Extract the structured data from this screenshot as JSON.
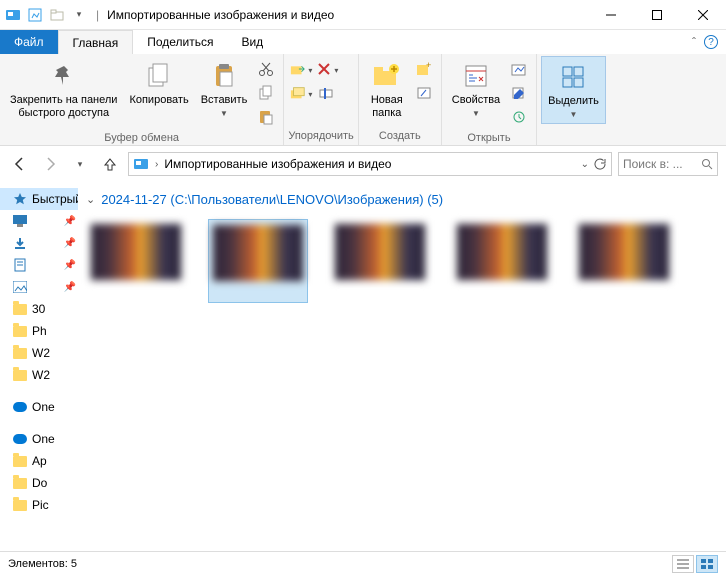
{
  "window": {
    "title": "Импортированные изображения и видео"
  },
  "tabs": {
    "file": "Файл",
    "home": "Главная",
    "share": "Поделиться",
    "view": "Вид"
  },
  "ribbon": {
    "pin": "Закрепить на панели\nбыстрого доступа",
    "copy": "Копировать",
    "paste": "Вставить",
    "clipboard_group": "Буфер обмена",
    "organize_group": "Упорядочить",
    "new_folder": "Новая\nпапка",
    "create_group": "Создать",
    "properties": "Свойства",
    "open_group": "Открыть",
    "select": "Выделить",
    "select_group": ""
  },
  "address": {
    "path": "Импортированные изображения и видео",
    "search_placeholder": "Поиск в: ..."
  },
  "nav": {
    "quick": "Быстрый доступ",
    "items": [
      {
        "label": "30"
      },
      {
        "label": "Ph"
      },
      {
        "label": "W2"
      },
      {
        "label": "W2"
      }
    ],
    "one1": "One",
    "one2": "One",
    "sub": [
      {
        "label": "Ap"
      },
      {
        "label": "Do"
      },
      {
        "label": "Pic"
      }
    ]
  },
  "group": {
    "title": "2024-11-27 (C:\\Пользователи\\LENOVO\\Изображения) (5)"
  },
  "status": {
    "text": "Элементов: 5"
  }
}
